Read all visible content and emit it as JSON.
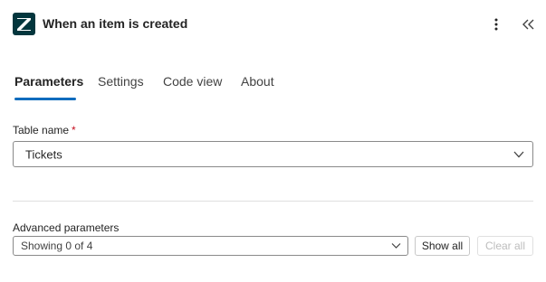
{
  "header": {
    "title": "When an item is created",
    "logo_icon": "zendesk-logo",
    "more_icon": "more-vertical-icon",
    "collapse_icon": "double-chevron-left-icon"
  },
  "tabs": [
    {
      "label": "Parameters",
      "active": true
    },
    {
      "label": "Settings",
      "active": false
    },
    {
      "label": "Code view",
      "active": false
    },
    {
      "label": "About",
      "active": false
    }
  ],
  "table_name": {
    "label": "Table name",
    "required_mark": "*",
    "value": "Tickets"
  },
  "advanced": {
    "label": "Advanced parameters",
    "value": "Showing 0 of 4",
    "show_all": "Show all",
    "clear_all": "Clear all"
  },
  "colors": {
    "accent": "#0f6cbd",
    "logo_bg": "#03363d",
    "required": "#c50f1f"
  }
}
